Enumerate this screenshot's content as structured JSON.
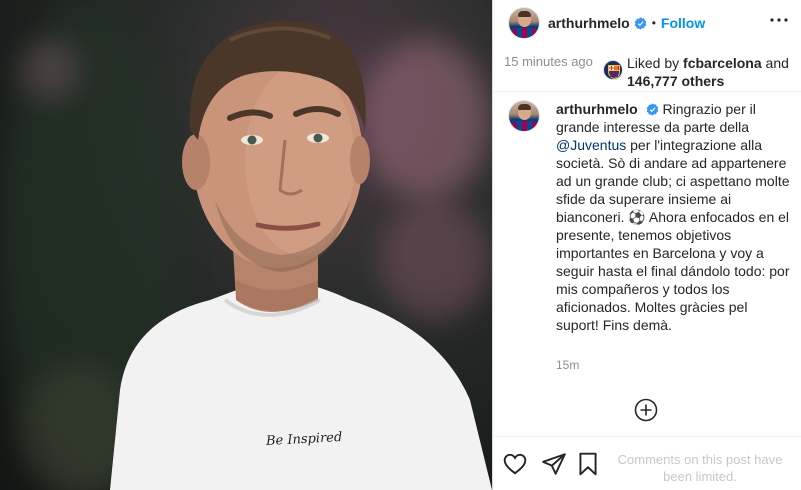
{
  "post": {
    "username": "arthurhmelo",
    "follow_sep": "•",
    "follow_label": "Follow",
    "time_ago": "15 minutes ago",
    "liked_by_prefix": "Liked by",
    "liked_by_user": "fcbarcelona",
    "liked_by_and": "and",
    "liked_by_count": "146,777 others",
    "shirt_text": "Be Inspired",
    "caption": {
      "username": "arthurhmelo",
      "text_part1": "Ringrazio per il grande interesse da parte della",
      "mention": "@Juventus",
      "text_part2": "per l'integrazione alla società. Sò di andare ad appartenere ad un grande club; ci aspettano molte sfide da superare insieme ai bianconeri. ⚽ Ahora enfocados en el presente, tenemos objetivos importantes en Barcelona y voy a seguir hasta el final dándolo todo: por mis compañeros y todos los aficionados. Moltes gràcies pel suport! Fins demà.",
      "time": "15m"
    },
    "comments_limited": "Comments on this post have been limited."
  },
  "icons": {
    "verified": "verified-badge-icon",
    "more": "more-options-icon",
    "load_more": "plus-circle-icon",
    "like": "heart-icon",
    "share": "paper-plane-icon",
    "save": "bookmark-icon"
  },
  "colors": {
    "accent": "#0095f6",
    "verified": "#3897f0",
    "muted": "#8e8e8e",
    "limited": "#c7c7c7"
  }
}
